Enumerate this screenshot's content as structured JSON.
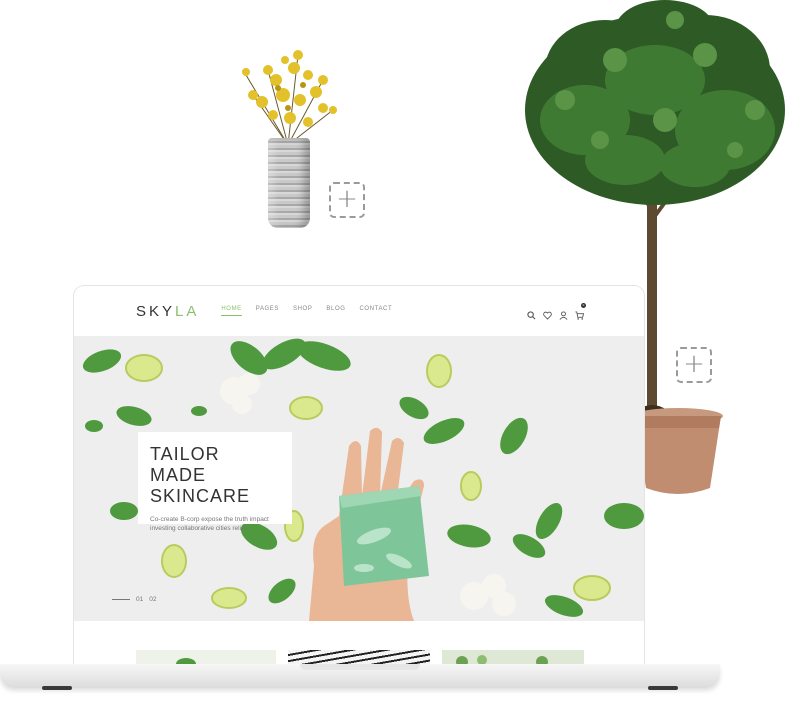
{
  "site": {
    "logo_main": "SKY",
    "logo_accent": "LA",
    "nav": [
      {
        "label": "HOME",
        "active": true
      },
      {
        "label": "PAGES",
        "active": false
      },
      {
        "label": "SHOP",
        "active": false
      },
      {
        "label": "BLOG",
        "active": false
      },
      {
        "label": "CONTACT",
        "active": false
      }
    ],
    "icons": [
      "search-icon",
      "heart-icon",
      "user-icon",
      "cart-icon"
    ],
    "cart_count": "0"
  },
  "hero": {
    "title_line1": "TAILOR MADE",
    "title_line2": "SKINCARE",
    "description": "Co-create B-corp expose the truth impact investing collaborative cities relief.",
    "slide_current": "01",
    "slide_next": "02"
  },
  "colors": {
    "accent": "#8bbf6b",
    "soap": "#7fc59a"
  }
}
